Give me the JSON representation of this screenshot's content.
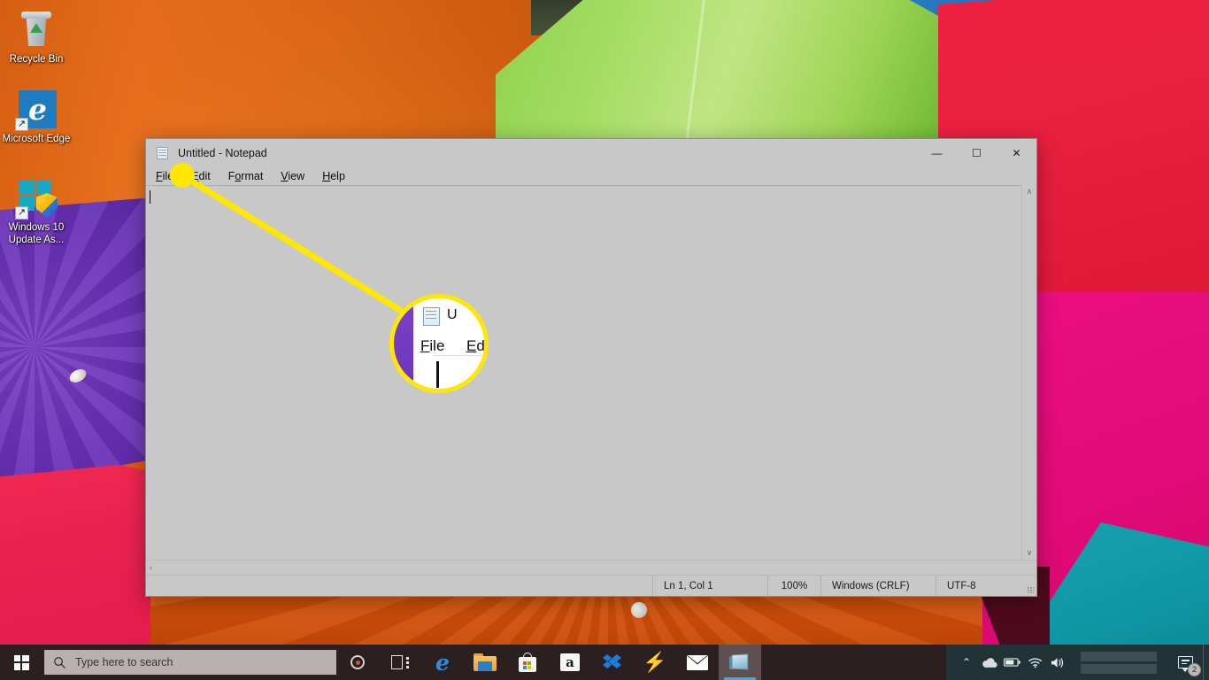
{
  "desktop": {
    "icons": [
      {
        "name": "recycle-bin",
        "label": "Recycle Bin"
      },
      {
        "name": "microsoft-edge",
        "label": "Microsoft Edge"
      },
      {
        "name": "windows-update-assistant",
        "label": "Windows 10 Update As..."
      }
    ]
  },
  "notepad": {
    "title": "Untitled - Notepad",
    "icon": "notepad-document-icon",
    "window_controls": {
      "minimize": "—",
      "maximize": "☐",
      "close": "✕"
    },
    "menu": [
      {
        "name": "file",
        "accel": "F",
        "rest": "ile"
      },
      {
        "name": "edit",
        "accel": "E",
        "rest": "dit"
      },
      {
        "name": "format",
        "accel": "F",
        "rest": "ormat",
        "pre": "F",
        "mid": "o",
        "post": "rmat"
      },
      {
        "name": "view",
        "accel": "V",
        "rest": "iew"
      },
      {
        "name": "help",
        "accel": "H",
        "rest": "elp"
      }
    ],
    "menu_labels": {
      "file": "File",
      "edit": "Edit",
      "format": "Format",
      "view": "View",
      "help": "Help"
    },
    "document_text": "",
    "scrollbars": {
      "up_arrow": "∧",
      "down_arrow": "∨",
      "left_arrow": "‹",
      "right_arrow": "›"
    },
    "status_bar": {
      "position": "Ln 1, Col 1",
      "zoom": "100%",
      "line_ending": "Windows (CRLF)",
      "encoding": "UTF-8"
    }
  },
  "callout": {
    "color": "#ffe800",
    "target": "file-menu",
    "magnifier": {
      "title_fragment": "U",
      "menu_item_1": "File",
      "menu_item_2": "Ed",
      "accel_1": "F",
      "accel_1_rest": "ile",
      "accel_2": "E",
      "accel_2_rest": "d"
    }
  },
  "taskbar": {
    "start_label": "Start",
    "search": {
      "placeholder": "Type here to search",
      "icon": "search-icon"
    },
    "cortana": "cortana-icon",
    "apps": [
      {
        "name": "task-view",
        "label": "Task View"
      },
      {
        "name": "microsoft-edge",
        "label": "Microsoft Edge"
      },
      {
        "name": "file-explorer",
        "label": "File Explorer"
      },
      {
        "name": "microsoft-store",
        "label": "Microsoft Store"
      },
      {
        "name": "amazon",
        "label": "Amazon"
      },
      {
        "name": "dropbox",
        "label": "Dropbox"
      },
      {
        "name": "lightning-app",
        "label": "Lightning"
      },
      {
        "name": "mail",
        "label": "Mail"
      },
      {
        "name": "notepad",
        "label": "Untitled - Notepad",
        "active": true
      }
    ],
    "tray": {
      "show_hidden": "⌃",
      "onedrive": "onedrive-cloud-icon",
      "battery": "battery-icon",
      "network": "wifi-icon",
      "volume": "speaker-icon",
      "clock": "",
      "action_center_badge": "2"
    }
  },
  "colors": {
    "callout_yellow": "#ffe800",
    "window_chrome": "#c8c8c8",
    "taskbar": "#2b1f1f",
    "taskbar_tray": "#223338",
    "accent_blue": "#3ea8e8"
  }
}
